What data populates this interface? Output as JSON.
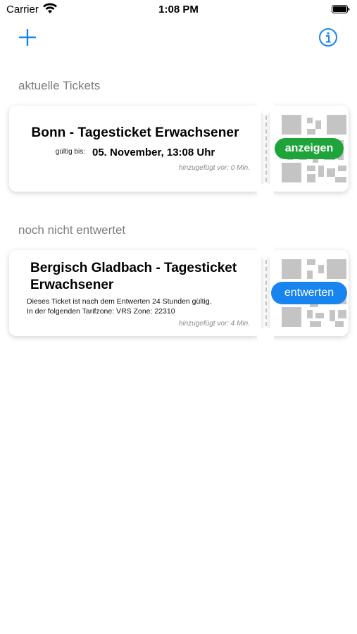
{
  "status_bar": {
    "carrier": "Carrier",
    "time": "1:08 PM"
  },
  "nav": {
    "add_icon": "plus-icon",
    "info_icon": "info-circle-icon",
    "accent_color": "#1784f0"
  },
  "sections": [
    {
      "header": "aktuelle Tickets",
      "tickets": [
        {
          "title": "Bonn - Tagesticket Erwachsener",
          "valid_label": "gültig bis:",
          "valid_value": "05. November, 13:08 Uhr",
          "added": "hinzugefügt vor: 0 Min.",
          "button_label": "anzeigen",
          "button_color": "#1ea43a"
        }
      ]
    },
    {
      "header": "noch nicht entwertet",
      "tickets": [
        {
          "title_line1": "Bergisch Gladbach - Tagesticket",
          "title_line2": "Erwachsener",
          "description_line1": "Dieses Ticket ist nach dem Entwerten 24 Stunden gültig.",
          "description_line2": "In der folgenden Tarifzone: VRS Zone: 22310",
          "added": "hinzugefügt vor: 4 Min.",
          "button_label": "entwerten",
          "button_color": "#1784f0"
        }
      ]
    }
  ]
}
